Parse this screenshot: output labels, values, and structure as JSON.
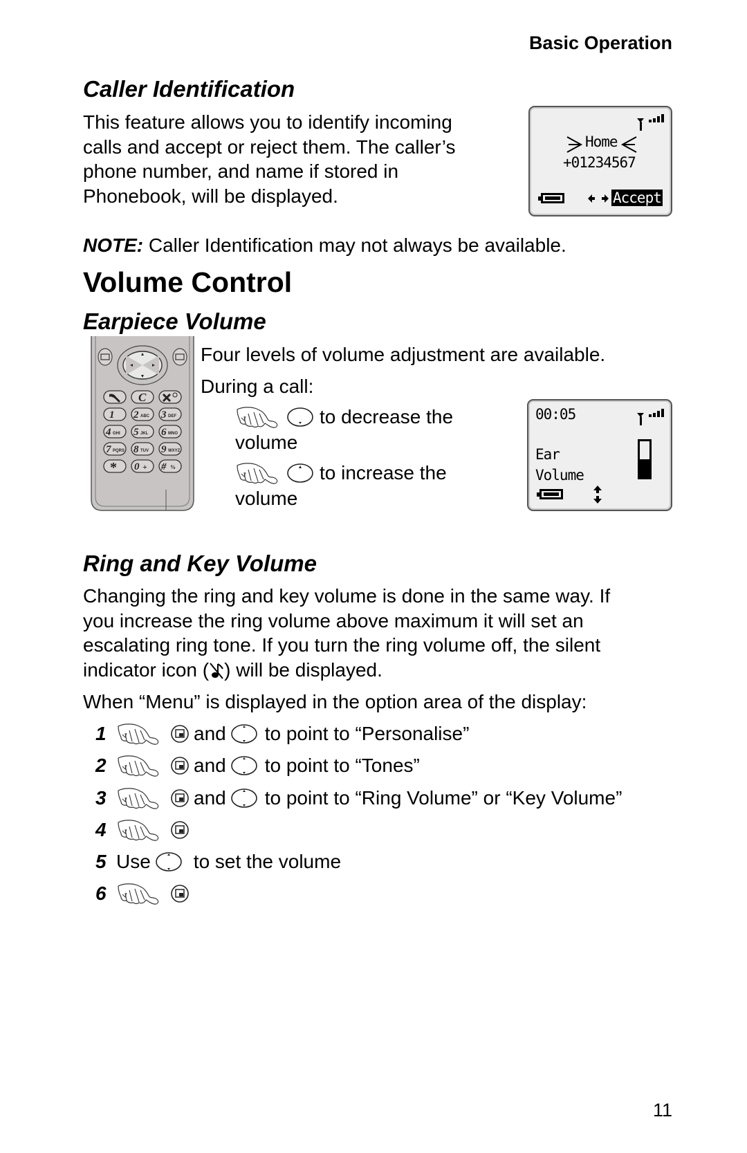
{
  "running_header": "Basic Operation",
  "caller_id": {
    "heading": "Caller Identification",
    "lines": [
      "This feature allows you to identify incoming",
      "calls and accept or reject them. The caller’s",
      "phone number, and name if stored in",
      "Phonebook, will be displayed."
    ],
    "screen": {
      "name": "Home",
      "number": "+01234567",
      "softkey": "Accept",
      "signal_icon": "signal-strength-icon",
      "battery_icon": "battery-icon",
      "nav_icon": "left-right-arrows-icon"
    },
    "note_label": "NOTE:",
    "note_text": " Caller Identification may not always be available."
  },
  "volume_control": {
    "heading": "Volume Control",
    "earpiece": {
      "heading": "Earpiece Volume",
      "intro": "Four levels of volume adjustment are available.",
      "during": "During a call:",
      "decrease_text": "to decrease the",
      "decrease_text2": "volume",
      "increase_text": "to increase the",
      "increase_text2": "volume",
      "phone_keys": {
        "row1": [
          "send",
          "C",
          "end"
        ],
        "row2": [
          "1",
          "2ABC",
          "3DEF"
        ],
        "row3": [
          "4GHI",
          "5JKL",
          "6MNO"
        ],
        "row4": [
          "7PQRS",
          "8TUV",
          "9WXYZ"
        ],
        "row5": [
          "*",
          "0+",
          "#"
        ]
      },
      "screen": {
        "timer": "00:05",
        "label1": "Ear",
        "label2": "Volume",
        "volume_level_fraction": 0.5,
        "signal_icon": "signal-strength-icon",
        "battery_icon": "battery-icon",
        "nav_icon": "up-down-arrows-icon"
      }
    },
    "ring_key": {
      "heading": "Ring and Key Volume",
      "lines": [
        "Changing the ring and key volume is done in the same way. If",
        "you increase the ring volume above maximum it will set an",
        "escalating ring tone. If you turn the ring volume off, the silent",
        "indicator icon (",
        ") will be displayed."
      ],
      "menu_intro": "When “Menu” is displayed in the option area of the display:",
      "and": "and",
      "steps": [
        {
          "num": "1",
          "text": "to point to “Personalise”"
        },
        {
          "num": "2",
          "text": "to point to “Tones”"
        },
        {
          "num": "3",
          "text": "to point to “Ring Volume” or “Key Volume”"
        },
        {
          "num": "4",
          "text": ""
        },
        {
          "num": "5",
          "pre": "Use",
          "text": "to set the volume"
        },
        {
          "num": "6",
          "text": ""
        }
      ]
    }
  },
  "page_number": "11"
}
